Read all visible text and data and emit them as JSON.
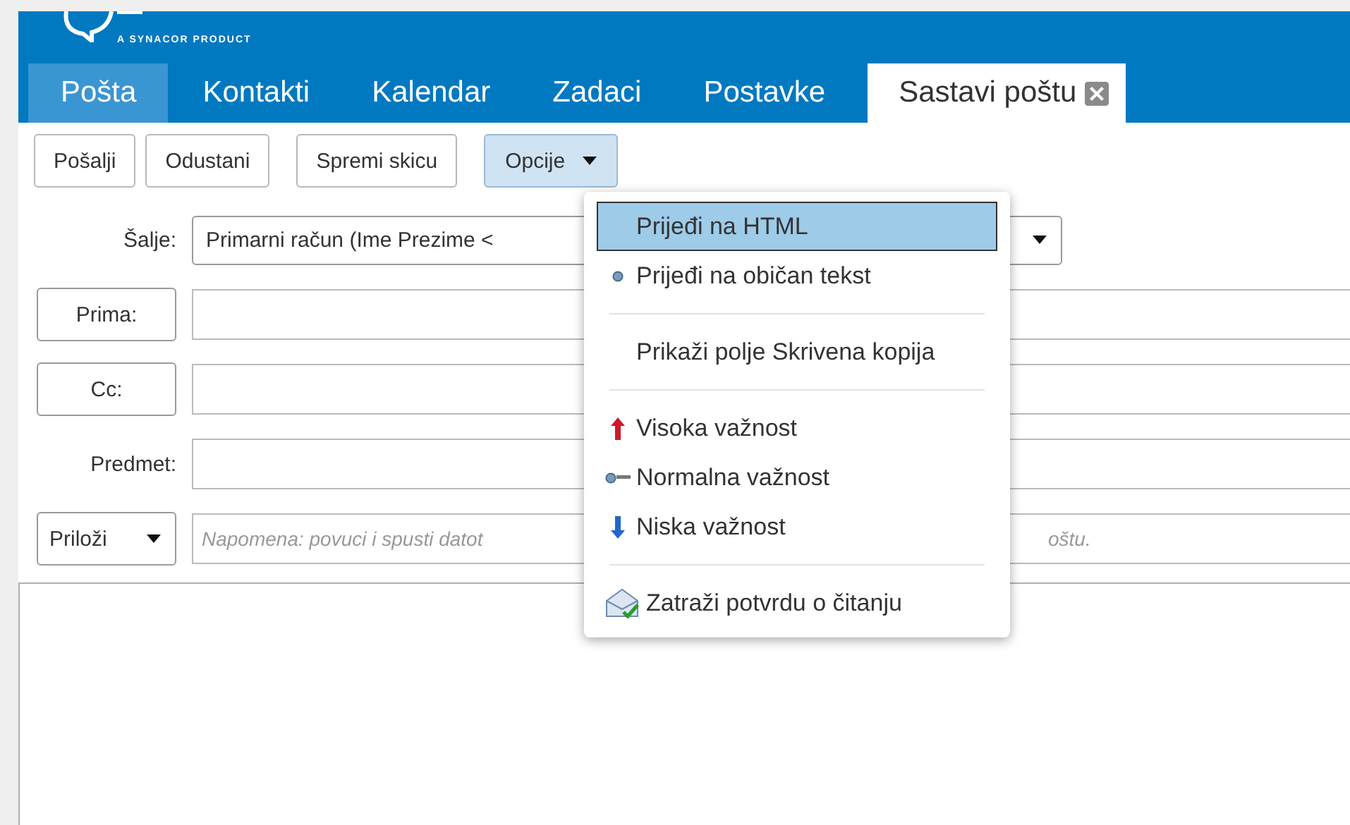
{
  "logo": {
    "tagline": "A SYNACOR PRODUCT"
  },
  "tabs": [
    {
      "label": "Pošta",
      "selected": false,
      "highlighted": true
    },
    {
      "label": "Kontakti",
      "selected": false,
      "highlighted": false
    },
    {
      "label": "Kalendar",
      "selected": false,
      "highlighted": false
    },
    {
      "label": "Zadaci",
      "selected": false,
      "highlighted": false
    },
    {
      "label": "Postavke",
      "selected": false,
      "highlighted": false
    },
    {
      "label": "Sastavi poštu",
      "selected": true,
      "highlighted": false,
      "closable": true
    }
  ],
  "toolbar": [
    {
      "label": "Pošalji",
      "pressed": false,
      "dropdown": false
    },
    {
      "label": "Odustani",
      "pressed": false,
      "dropdown": false
    },
    {
      "label": "Spremi skicu",
      "pressed": false,
      "dropdown": false
    },
    {
      "label": "Opcije",
      "pressed": true,
      "dropdown": true
    }
  ],
  "form": {
    "from": {
      "label": "Šalje:",
      "value": "Primarni račun (Ime Prezime <"
    },
    "to": {
      "label": "Prima:"
    },
    "cc": {
      "label": "Cc:"
    },
    "subject": {
      "label": "Predmet:"
    },
    "attach": {
      "label": "Priloži",
      "placeholder_start": "Napomena: povuci i spusti datot",
      "placeholder_end": "oštu."
    }
  },
  "menu": {
    "groups": [
      [
        {
          "kind": "format",
          "label": "Prijeđi na HTML",
          "selected": true,
          "checked": false
        },
        {
          "kind": "format",
          "label": "Prijeđi na običan tekst",
          "selected": false,
          "checked": true
        }
      ],
      [
        {
          "kind": "toggle",
          "label": "Prikaži polje Skrivena kopija",
          "selected": false
        }
      ],
      [
        {
          "kind": "high",
          "label": "Visoka važnost",
          "selected": false,
          "checked": false
        },
        {
          "kind": "normal",
          "label": "Normalna važnost",
          "selected": false,
          "checked": true
        },
        {
          "kind": "low",
          "label": "Niska važnost",
          "selected": false,
          "checked": false
        }
      ],
      [
        {
          "kind": "receipt",
          "label": "Zatraži potvrdu o čitanju",
          "selected": false
        }
      ]
    ]
  }
}
